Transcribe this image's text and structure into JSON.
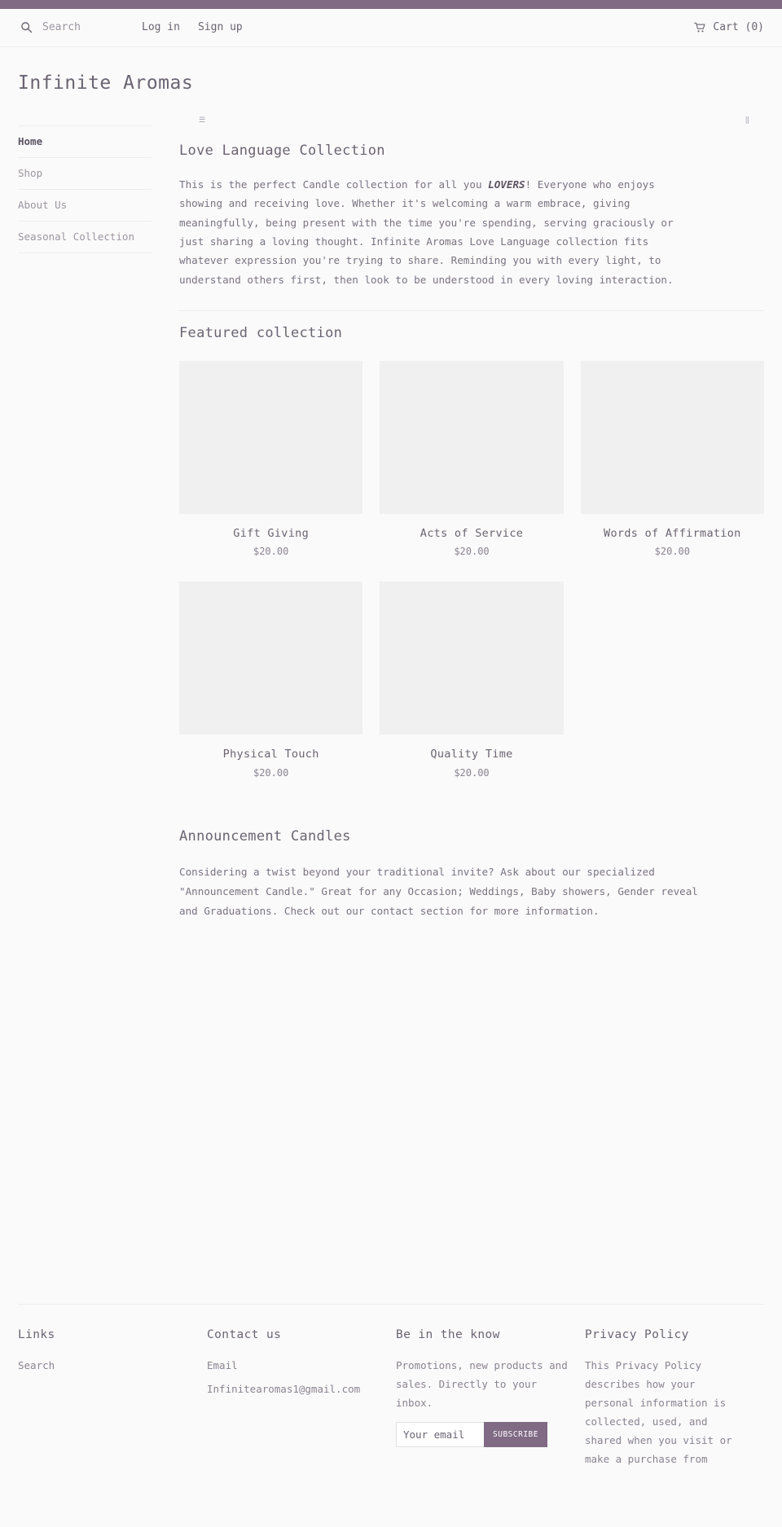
{
  "theme": {
    "accent": "#806a84",
    "page_bg": "#fafafa",
    "text": "#6b6472",
    "muted_text": "#8a8391",
    "rule": "#ededed",
    "thumb_bg": "#f0f0f0"
  },
  "topbar": {
    "search_icon": "search-icon",
    "search_placeholder": "Search",
    "search_value": "",
    "login_label": "Log in",
    "signup_label": "Sign up",
    "cart_icon": "shopping-cart-icon",
    "cart_label": "Cart (0)"
  },
  "site": {
    "title": "Infinite Aromas"
  },
  "sidebar": {
    "items": [
      {
        "label": "Home",
        "active": true
      },
      {
        "label": "Shop",
        "active": false
      },
      {
        "label": "About Us",
        "active": false
      },
      {
        "label": "Seasonal Collection",
        "active": false
      }
    ]
  },
  "glyphs": {
    "left": "☰",
    "right": "‖"
  },
  "collection": {
    "title": "Love Language Collection",
    "description_pre": "This is the perfect Candle collection for all you ",
    "description_em": "LOVERS",
    "description_post": "! Everyone who enjoys showing and receiving love. Whether it's welcoming a warm embrace, giving meaningfully, being present with the time you're spending, serving graciously or just sharing a loving thought. Infinite Aromas Love Language collection fits whatever expression you're trying to share. Reminding you with every light, to understand others first, then look to be understood in every loving interaction."
  },
  "featured": {
    "heading": "Featured collection",
    "products": [
      {
        "name": "Gift Giving",
        "price": "$20.00",
        "thumb": "product-image-placeholder"
      },
      {
        "name": "Acts of Service",
        "price": "$20.00",
        "thumb": "product-image-placeholder"
      },
      {
        "name": "Words of Affirmation",
        "price": "$20.00",
        "thumb": "product-image-placeholder"
      },
      {
        "name": "Physical Touch",
        "price": "$20.00",
        "thumb": "product-image-placeholder"
      },
      {
        "name": "Quality Time",
        "price": "$20.00",
        "thumb": "product-image-placeholder"
      }
    ]
  },
  "announcement": {
    "heading": "Announcement Candles",
    "body": "Considering a twist beyond your traditional invite? Ask about our specialized \"Announcement Candle.\" Great for any Occasion; Weddings, Baby showers, Gender reveal and Graduations. Check out our contact section for more information."
  },
  "footer": {
    "links": {
      "heading": "Links",
      "items": [
        "Search"
      ]
    },
    "contact": {
      "heading": "Contact us",
      "label": "Email",
      "email": "Infinitearomas1@gmail.com"
    },
    "newsletter": {
      "heading": "Be in the know",
      "blurb": "Promotions, new products and sales. Directly to your inbox.",
      "email_placeholder": "Your email",
      "email_value": "",
      "subscribe_label": "SUBSCRIBE"
    },
    "privacy": {
      "heading": "Privacy Policy",
      "body": "This Privacy Policy describes how your personal information is collected, used, and shared when you visit or make a purchase from"
    }
  }
}
